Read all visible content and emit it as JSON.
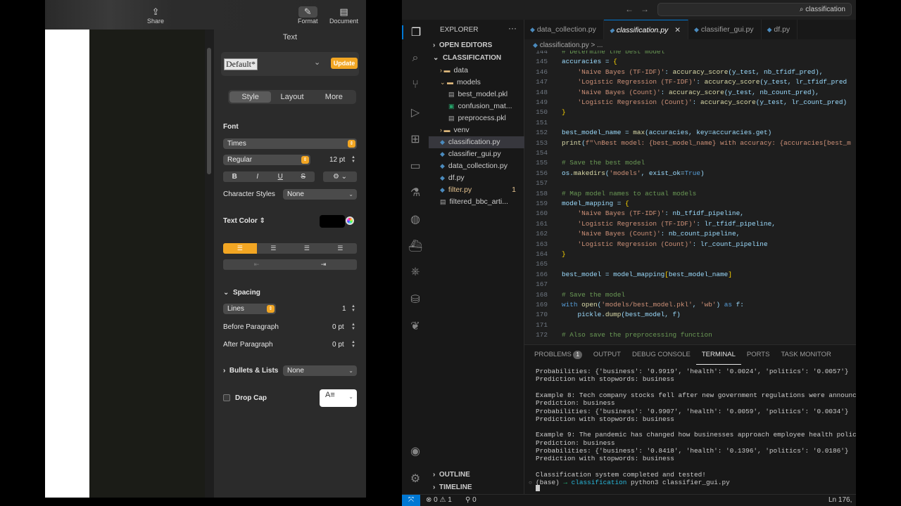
{
  "pages": {
    "toolbar": {
      "share": "Share",
      "format": "Format",
      "document": "Document"
    },
    "inspector": {
      "title": "Text",
      "paragraph_style": "Default*",
      "update": "Update",
      "tabs": [
        "Style",
        "Layout",
        "More"
      ],
      "font_label": "Font",
      "font_family": "Times",
      "font_style": "Regular",
      "font_size": "12 pt",
      "format_buttons": [
        "B",
        "I",
        "U",
        "S"
      ],
      "char_styles_label": "Character Styles",
      "char_styles_value": "None",
      "text_color_label": "Text Color",
      "spacing_label": "Spacing",
      "spacing_mode": "Lines",
      "spacing_value": "1",
      "before_label": "Before Paragraph",
      "before_value": "0 pt",
      "after_label": "After Paragraph",
      "after_value": "0 pt",
      "bullets_label": "Bullets & Lists",
      "bullets_value": "None",
      "dropcap_label": "Drop Cap"
    }
  },
  "vscode": {
    "search": "classification",
    "explorer_title": "EXPLORER",
    "open_editors": "OPEN EDITORS",
    "project": "CLASSIFICATION",
    "tree": [
      {
        "label": "data",
        "type": "folder",
        "depth": 1,
        "open": false
      },
      {
        "label": "models",
        "type": "folder",
        "depth": 1,
        "open": true
      },
      {
        "label": "best_model.pkl",
        "type": "file",
        "depth": 2
      },
      {
        "label": "confusion_mat...",
        "type": "image",
        "depth": 2
      },
      {
        "label": "preprocess.pkl",
        "type": "file",
        "depth": 2
      },
      {
        "label": "venv",
        "type": "folder",
        "depth": 1,
        "open": false
      },
      {
        "label": "classification.py",
        "type": "py",
        "depth": 1,
        "selected": true
      },
      {
        "label": "classifier_gui.py",
        "type": "py",
        "depth": 1
      },
      {
        "label": "data_collection.py",
        "type": "py",
        "depth": 1
      },
      {
        "label": "df.py",
        "type": "py",
        "depth": 1
      },
      {
        "label": "filter.py",
        "type": "py",
        "depth": 1,
        "modified": true,
        "badge": "1"
      },
      {
        "label": "filtered_bbc_arti...",
        "type": "file",
        "depth": 1
      }
    ],
    "outline": "OUTLINE",
    "timeline": "TIMELINE",
    "tabs": [
      {
        "label": "data_collection.py",
        "active": false
      },
      {
        "label": "classification.py",
        "active": true
      },
      {
        "label": "classifier_gui.py",
        "active": false
      },
      {
        "label": "df.py",
        "active": false
      }
    ],
    "breadcrumb": "classification.py > ...",
    "code": [
      {
        "n": "144",
        "t": "# Determine the best model"
      },
      {
        "n": "145",
        "t": "accuracies = {"
      },
      {
        "n": "146",
        "t": "    'Naive Bayes (TF-IDF)': accuracy_score(y_test, nb_tfidf_pred),"
      },
      {
        "n": "147",
        "t": "    'Logistic Regression (TF-IDF)': accuracy_score(y_test, lr_tfidf_pred"
      },
      {
        "n": "148",
        "t": "    'Naive Bayes (Count)': accuracy_score(y_test, nb_count_pred),"
      },
      {
        "n": "149",
        "t": "    'Logistic Regression (Count)': accuracy_score(y_test, lr_count_pred)"
      },
      {
        "n": "150",
        "t": "}"
      },
      {
        "n": "151",
        "t": ""
      },
      {
        "n": "152",
        "t": "best_model_name = max(accuracies, key=accuracies.get)"
      },
      {
        "n": "153",
        "t": "print(f\"\\nBest model: {best_model_name} with accuracy: {accuracies[best_m"
      },
      {
        "n": "154",
        "t": ""
      },
      {
        "n": "155",
        "t": "# Save the best model"
      },
      {
        "n": "156",
        "t": "os.makedirs('models', exist_ok=True)"
      },
      {
        "n": "157",
        "t": ""
      },
      {
        "n": "158",
        "t": "# Map model names to actual models"
      },
      {
        "n": "159",
        "t": "model_mapping = {"
      },
      {
        "n": "160",
        "t": "    'Naive Bayes (TF-IDF)': nb_tfidf_pipeline,"
      },
      {
        "n": "161",
        "t": "    'Logistic Regression (TF-IDF)': lr_tfidf_pipeline,"
      },
      {
        "n": "162",
        "t": "    'Naive Bayes (Count)': nb_count_pipeline,"
      },
      {
        "n": "163",
        "t": "    'Logistic Regression (Count)': lr_count_pipeline"
      },
      {
        "n": "164",
        "t": "}"
      },
      {
        "n": "165",
        "t": ""
      },
      {
        "n": "166",
        "t": "best_model = model_mapping[best_model_name]"
      },
      {
        "n": "167",
        "t": ""
      },
      {
        "n": "168",
        "t": "# Save the model"
      },
      {
        "n": "169",
        "t": "with open('models/best_model.pkl', 'wb') as f:"
      },
      {
        "n": "170",
        "t": "    pickle.dump(best_model, f)"
      },
      {
        "n": "171",
        "t": ""
      },
      {
        "n": "172",
        "t": "# Also save the preprocessing function"
      }
    ],
    "panel_tabs": [
      {
        "label": "PROBLEMS",
        "badge": "1"
      },
      {
        "label": "OUTPUT"
      },
      {
        "label": "DEBUG CONSOLE"
      },
      {
        "label": "TERMINAL",
        "active": true
      },
      {
        "label": "PORTS"
      },
      {
        "label": "TASK MONITOR"
      }
    ],
    "terminal": [
      "Probabilities: {'business': '0.9919', 'health': '0.0024', 'politics': '0.0057'}",
      "Prediction with stopwords: business",
      "",
      "Example 8: Tech company stocks fell after new government regulations were announce",
      "Prediction: business",
      "Probabilities: {'business': '0.9907', 'health': '0.0059', 'politics': '0.0034'}",
      "Prediction with stopwords: business",
      "",
      "Example 9: The pandemic has changed how businesses approach employee health polic",
      "Prediction: business",
      "Probabilities: {'business': '0.8418', 'health': '0.1396', 'politics': '0.0186'}",
      "Prediction with stopwords: business",
      "",
      "Classification system completed and tested!",
      "(base) → classification python3 classifier_gui.py"
    ],
    "status": {
      "errors": "0",
      "warnings": "1",
      "ports": "0",
      "position": "Ln 176,"
    }
  }
}
